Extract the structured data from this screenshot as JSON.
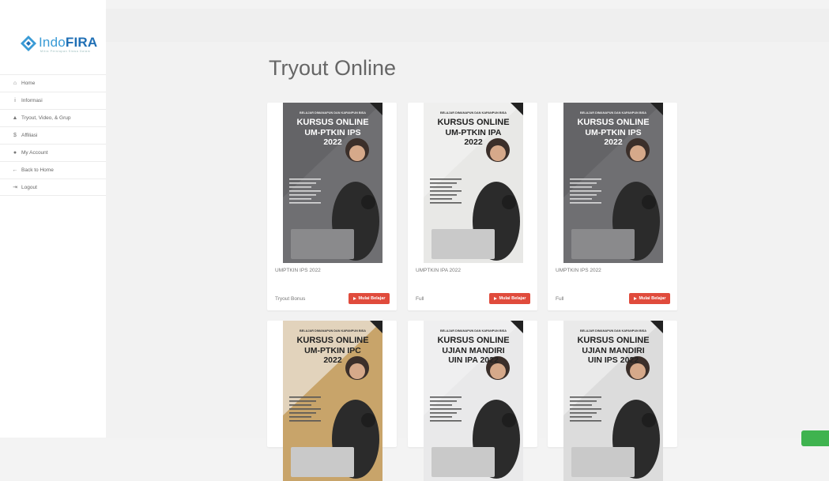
{
  "brand": {
    "name_light": "Indo",
    "name_bold": "FIRA",
    "tagline": "Mitra Persiapan Siswa Dalam"
  },
  "sidebar": {
    "items": [
      {
        "label": "Home",
        "icon": "home-icon"
      },
      {
        "label": "Informasi",
        "icon": "info-icon"
      },
      {
        "label": "Tryout, Video, & Grup",
        "icon": "graduation-cap-icon"
      },
      {
        "label": "Affiliasi",
        "icon": "dollar-icon"
      },
      {
        "label": "My Account",
        "icon": "user-icon"
      },
      {
        "label": "Back to Home",
        "icon": "arrow-left-icon"
      },
      {
        "label": "Logout",
        "icon": "logout-icon"
      }
    ]
  },
  "page": {
    "title": "Tryout Online"
  },
  "cards": [
    {
      "name": "UMPTKIN IPS 2022",
      "type": "Tryout Bonus",
      "button": "Mulai Belajar",
      "cover": {
        "tagline": "BELAJAR DIMANAPUN DAN KAPANPUN BISA",
        "line1": "KURSUS ONLINE",
        "line2": "UM-PTKIN IPS",
        "line3": "2022",
        "bg": "#6f6f72"
      }
    },
    {
      "name": "UMPTKIN IPA 2022",
      "type": "Full",
      "button": "Mulai Belajar",
      "cover": {
        "tagline": "BELAJAR DIMANAPUN DAN KAPANPUN BISA",
        "line1": "KURSUS ONLINE",
        "line2": "UM-PTKIN IPA",
        "line3": "2022",
        "bg": "#e8e8e6"
      }
    },
    {
      "name": "UMPTKIN IPS 2022",
      "type": "Full",
      "button": "Mulai Belajar",
      "cover": {
        "tagline": "BELAJAR DIMANAPUN DAN KAPANPUN BISA",
        "line1": "KURSUS ONLINE",
        "line2": "UM-PTKIN IPS",
        "line3": "2022",
        "bg": "#6f6f72"
      }
    },
    {
      "name": "",
      "type": "",
      "button": "",
      "cover": {
        "tagline": "BELAJAR DIMANAPUN DAN KAPANPUN BISA",
        "line1": "KURSUS ONLINE",
        "line2": "UM-PTKIN IPC",
        "line3": "2022",
        "bg": "#c8a46a"
      }
    },
    {
      "name": "",
      "type": "",
      "button": "",
      "cover": {
        "tagline": "BELAJAR DIMANAPUN DAN KAPANPUN BISA",
        "line1": "KURSUS ONLINE",
        "line2": "UJIAN MANDIRI",
        "line3": "UIN IPA 2022",
        "bg": "#e9e9ea"
      }
    },
    {
      "name": "",
      "type": "",
      "button": "",
      "cover": {
        "tagline": "BELAJAR DIMANAPUN DAN KAPANPUN BISA",
        "line1": "KURSUS ONLINE",
        "line2": "UJIAN MANDIRI",
        "line3": "UIN IPS 2022",
        "bg": "#dcdcdc"
      }
    }
  ]
}
